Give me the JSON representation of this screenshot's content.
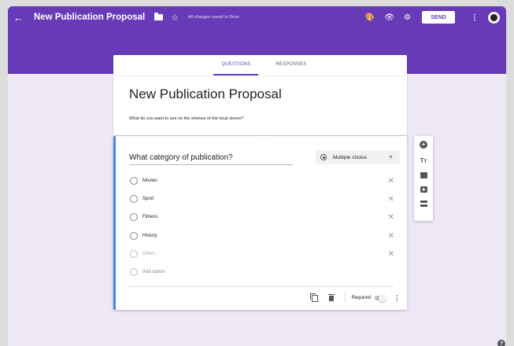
{
  "topbar": {
    "back_glyph": "←",
    "title": "New Publication Proposal",
    "saved_status": "All changes saved in Drive",
    "send_label": "SEND",
    "icons": [
      "arrow-back",
      "folder",
      "star",
      "palette",
      "eye",
      "gear",
      "more-vert",
      "avatar"
    ]
  },
  "tabs": [
    {
      "label": "QUESTIONS",
      "active": true
    },
    {
      "label": "RESPONSES",
      "active": false
    }
  ],
  "form": {
    "title": "New Publication Proposal",
    "description": "What do you want to see on the shelves of the local stores?"
  },
  "question": {
    "drag_handle": ":::",
    "title": "What category of publication?",
    "type": "Multiple choice",
    "options": [
      "Movies",
      "Sport",
      "Fitness",
      "History"
    ],
    "other_placeholder": "Other...",
    "add_option": "Add option",
    "required_label": "Required",
    "required": false
  },
  "sidebar": {
    "title_icon_glyph": "Tт"
  },
  "colors": {
    "header_purple": "#673ab7",
    "background": "#ede7f6",
    "active_accent": "#4285f4"
  }
}
